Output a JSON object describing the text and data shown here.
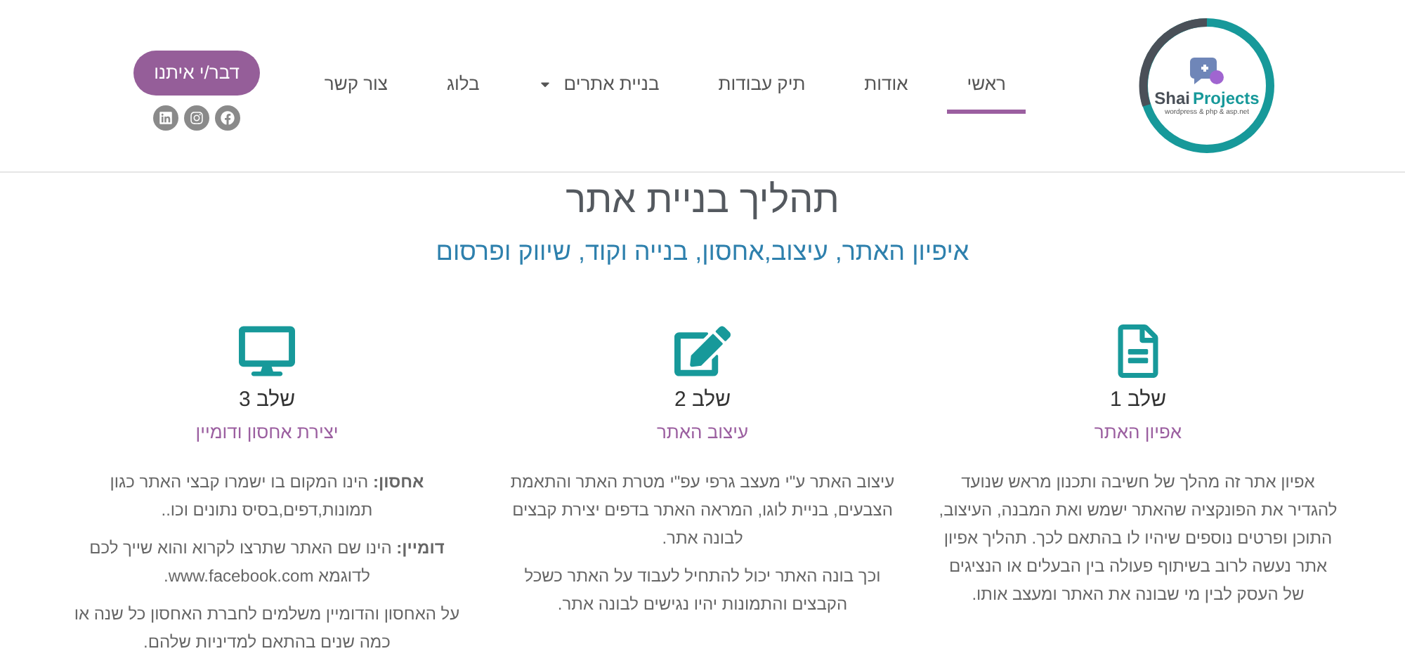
{
  "logo": {
    "name_first": "Shai",
    "name_second": "Projects",
    "tagline": "wordpress & php & asp.net"
  },
  "nav": [
    {
      "label": "ראשי",
      "selected": true,
      "has_dropdown": false
    },
    {
      "label": "אודות",
      "selected": false,
      "has_dropdown": false
    },
    {
      "label": "תיק עבודות",
      "selected": false,
      "has_dropdown": false
    },
    {
      "label": "בניית אתרים",
      "selected": false,
      "has_dropdown": true
    },
    {
      "label": "בלוג",
      "selected": false,
      "has_dropdown": false
    },
    {
      "label": "צור קשר",
      "selected": false,
      "has_dropdown": false
    }
  ],
  "cta_button": "דבר/י איתנו",
  "social": [
    {
      "kind": "facebook"
    },
    {
      "kind": "instagram"
    },
    {
      "kind": "linkedin"
    }
  ],
  "title": "תהליך בניית אתר",
  "subtitle": "איפיון האתר, עיצוב,אחסון, בנייה וקוד, שיווק ופרסום",
  "steps": [
    {
      "step_label": "שלב 1",
      "title": "אפיון האתר",
      "paragraphs": [
        "אפיון אתר זה מהלך של חשיבה ותכנון מראש שנועד להגדיר את הפונקציה שהאתר ישמש ואת המבנה, העיצוב, התוכן ופרטים נוספים שיהיו לו בהתאם לכך. תהליך אפיון אתר נעשה לרוב בשיתוף פעולה בין הבעלים או הנציגים של העסק לבין מי שבונה את האתר ומעצב אותו."
      ]
    },
    {
      "step_label": "שלב 2",
      "title": "עיצוב האתר",
      "paragraphs": [
        "עיצוב האתר ע\"י מעצב גרפי עפ\"י מטרת האתר והתאמת הצבעים, בניית לוגו, המראה האתר בדפים יצירת קבצים לבונה אתר.",
        "וכך בונה האתר יכול להתחיל לעבוד על האתר כשכל הקבצים והתמונות יהיו נגישים לבונה אתר."
      ]
    },
    {
      "step_label": "שלב 3",
      "title": "יצירת אחסון ודומיין",
      "paragraphs": [
        "**אחסון:** הינו המקום בו ישמרו קבצי האתר כגון תמונות,דפים,בסיס נתונים וכו..",
        "**דומיין:** הינו שם האתר שתרצו לקרוא והוא שייך לכם לדוגמא www.facebook.com.",
        "על האחסון והדומיין משלמים לחברת האחסון כל שנה או כמה שנים בהתאם למדיניות שלהם."
      ]
    }
  ]
}
